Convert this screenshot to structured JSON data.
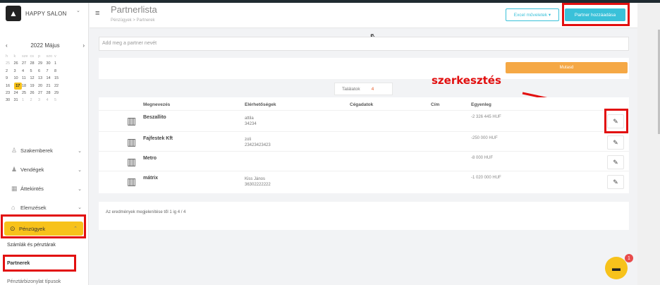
{
  "app": {
    "salon_name": "HAPPY SALON",
    "logo_glyph": "▲"
  },
  "calendar": {
    "month_label": "2022 Május",
    "prev": "‹",
    "next": "›",
    "weekdays": [
      "h",
      "k",
      "sze",
      "cs",
      "p",
      "szo",
      "v"
    ],
    "weeks": [
      [
        {
          "d": "25",
          "dim": true
        },
        {
          "d": "26",
          "dim": false
        },
        {
          "d": "27",
          "dim": false
        },
        {
          "d": "28",
          "dim": false
        },
        {
          "d": "29",
          "dim": false
        },
        {
          "d": "30",
          "dim": false
        },
        {
          "d": "1",
          "dim": false
        }
      ],
      [
        {
          "d": "2",
          "dim": false
        },
        {
          "d": "3",
          "dim": false
        },
        {
          "d": "4",
          "dim": false
        },
        {
          "d": "5",
          "dim": false
        },
        {
          "d": "6",
          "dim": false
        },
        {
          "d": "7",
          "dim": false
        },
        {
          "d": "8",
          "dim": false
        }
      ],
      [
        {
          "d": "9",
          "dim": false
        },
        {
          "d": "10",
          "dim": false
        },
        {
          "d": "11",
          "dim": false
        },
        {
          "d": "12",
          "dim": false
        },
        {
          "d": "13",
          "dim": false
        },
        {
          "d": "14",
          "dim": false
        },
        {
          "d": "15",
          "dim": false
        }
      ],
      [
        {
          "d": "16",
          "dim": false
        },
        {
          "d": "17",
          "sel": true
        },
        {
          "d": "18",
          "dim": false
        },
        {
          "d": "19",
          "dim": false
        },
        {
          "d": "20",
          "dim": false
        },
        {
          "d": "21",
          "dim": false
        },
        {
          "d": "22",
          "dim": false
        }
      ],
      [
        {
          "d": "23",
          "dim": false
        },
        {
          "d": "24",
          "dim": false
        },
        {
          "d": "25",
          "dim": false
        },
        {
          "d": "26",
          "dim": false
        },
        {
          "d": "27",
          "dim": false
        },
        {
          "d": "28",
          "dim": false
        },
        {
          "d": "29",
          "dim": false
        }
      ],
      [
        {
          "d": "30",
          "dim": false
        },
        {
          "d": "31",
          "dim": false
        },
        {
          "d": "1",
          "dim": true
        },
        {
          "d": "2",
          "dim": true
        },
        {
          "d": "3",
          "dim": true
        },
        {
          "d": "4",
          "dim": true
        },
        {
          "d": "5",
          "dim": true
        }
      ]
    ]
  },
  "nav": {
    "szakemberek": "Szakemberek",
    "vendegek": "Vendégek",
    "attekintes": "Áttekintés",
    "elemzesek": "Elemzések",
    "penzugyek": "Pénzügyek",
    "sub_szamlak": "Számlák és pénztárak",
    "sub_partnerek": "Partnerek",
    "sub_penztar": "Pénztárbizonylat típusok"
  },
  "header": {
    "title": "Partnerlista",
    "breadcrumb": "Pénzügyek  >  Partnerek",
    "excel_label": "Excel műveletek ▾",
    "add_label": "Partner hozzáadása"
  },
  "search": {
    "placeholder": "Add meg a partner nevét"
  },
  "filter": {
    "show_label": "Mutasd"
  },
  "results": {
    "label": "Találatok",
    "count": "4"
  },
  "table": {
    "headers": {
      "name": "Megnevezés",
      "contacts": "Elérhetőségek",
      "company": "Cégadatok",
      "address": "Cím",
      "balance": "Egyenleg"
    },
    "rows": [
      {
        "name": "Beszallito",
        "contact": "attila",
        "contact2": "34234",
        "balance": "-2 326 445 HUF"
      },
      {
        "name": "Fajfestek Kft",
        "contact": "zoli",
        "contact2": "23423423423",
        "balance": "-250 000 HUF"
      },
      {
        "name": "Metro",
        "contact": "",
        "contact2": "",
        "balance": "-8 000 HUF"
      },
      {
        "name": "mátrix",
        "contact": "Kiss János",
        "contact2": "36302222222",
        "balance": "-1 020 000 HUF"
      }
    ]
  },
  "footer": {
    "summary": "Az eredmények megjelenítése től 1 ig 4 / 4"
  },
  "annotation": {
    "label": "szerkesztés"
  },
  "chat": {
    "badge": "1"
  }
}
